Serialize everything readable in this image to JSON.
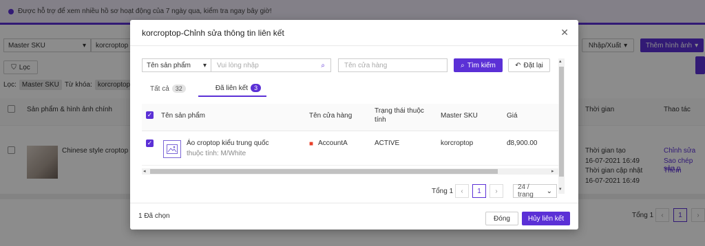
{
  "banner": {
    "text": "Được hỗ trợ để xem nhiều hồ sơ hoạt động của 7 ngày qua, kiểm tra ngay bây giờ!"
  },
  "bg": {
    "master_sku_select": "Master SKU",
    "keyword_value": "korcroptop",
    "import_export": "Nhập/Xuất",
    "add_image": "Thêm hình ảnh",
    "filter_button": "Lọc",
    "filter_label": "Lọc:",
    "filter_tag1": "Master SKU",
    "filter_keyword_label": "Từ khóa:",
    "filter_tag2": "korcroptop",
    "col_product": "Sản phẩm & hình ảnh chính",
    "col_time": "Thời gian",
    "col_action": "Thao tác",
    "product_name": "Chinese style croptop",
    "created_label": "Thời gian tạo",
    "created_value": "16-07-2021 16:49",
    "updated_label": "Thời gian cập nhật",
    "updated_value": "16-07-2021 16:49",
    "action_edit": "Chỉnh sửa",
    "action_copy": "Sao chép sản p",
    "action_more": "Thêm",
    "total_label": "Tổng 1",
    "page": "1"
  },
  "modal": {
    "title": "korcroptop-Chỉnh sửa thông tin liên kết",
    "search_field": "Tên sản phẩm",
    "search_placeholder": "Vui lòng nhập",
    "store_placeholder": "Tên cửa hàng",
    "search_button": "Tìm kiếm",
    "reset_button": "Đặt lại",
    "tabs": [
      {
        "label": "Tất cả",
        "count": "32"
      },
      {
        "label": "Đã liên kết",
        "count": "3"
      }
    ],
    "columns": {
      "product": "Tên sản phẩm",
      "store": "Tên cửa hàng",
      "status": "Trạng thái thuộc tính",
      "master_sku": "Master SKU",
      "price": "Giá"
    },
    "row": {
      "product_name": "Áo croptop kiểu trung quốc",
      "attribute": "thuộc tính: M/White",
      "store": "AccountA",
      "status": "ACTIVE",
      "master_sku": "korcroptop",
      "price": "đ8,900.00"
    },
    "pagination": {
      "total": "Tổng 1",
      "page": "1",
      "per_page": "24 / trang"
    },
    "footer": {
      "selected": "1 Đã chọn",
      "close_button": "Đóng",
      "unlink_button": "Hủy liên kết"
    },
    "colors": {
      "accent": "#5b30d6",
      "store_icon": "#e8402a"
    }
  }
}
